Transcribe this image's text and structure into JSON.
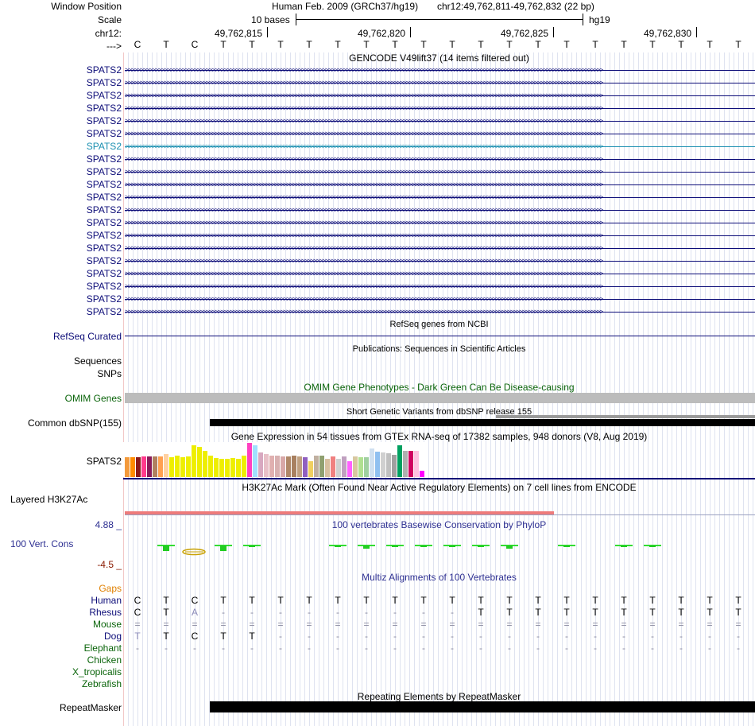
{
  "header": {
    "window_position_label": "Window Position",
    "scale_label": "Scale",
    "chrom_label": "chr12:",
    "strand_label": "--->",
    "assembly_text": "Human Feb. 2009 (GRCh37/hg19)",
    "position_text": "chr12:49,762,811-49,762,832 (22 bp)",
    "scale_text": "10 bases",
    "db_text": "hg19",
    "ticks": [
      "49,762,815",
      "49,762,820",
      "49,762,825",
      "49,762,830"
    ]
  },
  "sequence": [
    "C",
    "T",
    "C",
    "T",
    "T",
    "T",
    "T",
    "T",
    "T",
    "T",
    "T",
    "T",
    "T",
    "T",
    "T",
    "T",
    "T",
    "T",
    "T",
    "T",
    "T",
    "T"
  ],
  "gencode": {
    "title": "GENCODE V49lift37 (14 items filtered out)",
    "gene_labels": [
      "SPATS2",
      "SPATS2",
      "SPATS2",
      "SPATS2",
      "SPATS2",
      "SPATS2",
      "SPATS2",
      "SPATS2",
      "SPATS2",
      "SPATS2",
      "SPATS2",
      "SPATS2",
      "SPATS2",
      "SPATS2",
      "SPATS2",
      "SPATS2",
      "SPATS2",
      "SPATS2",
      "SPATS2",
      "SPATS2"
    ],
    "highlight_index": 6,
    "colors": {
      "normal": "#0c0c78",
      "highlight": "#1a8fb0"
    }
  },
  "refseq": {
    "label": "RefSeq Curated",
    "title": "RefSeq genes from NCBI",
    "color": "#0c0c78"
  },
  "pubs": {
    "title": "Publications: Sequences in Scientific Articles",
    "labels": [
      "Sequences",
      "SNPs"
    ]
  },
  "omim": {
    "label": "OMIM Genes",
    "title": "OMIM Gene Phenotypes - Dark Green Can Be Disease-causing",
    "color": "#0a640a"
  },
  "dbsnp": {
    "label": "Common dbSNP(155)",
    "title": "Short Genetic Variants from dbSNP release 155"
  },
  "gtex": {
    "label": "SPATS2",
    "title": "Gene Expression in 54 tissues from GTEx RNA-seq of 17382 samples, 948 donors (V8, Aug 2019)",
    "levels": [
      0.56,
      0.56,
      0.56,
      0.6,
      0.58,
      0.6,
      0.58,
      0.66,
      0.56,
      0.62,
      0.56,
      0.6,
      0.9,
      0.86,
      0.76,
      0.62,
      0.54,
      0.52,
      0.52,
      0.54,
      0.52,
      0.62,
      0.98,
      0.9,
      0.7,
      0.66,
      0.62,
      0.62,
      0.58,
      0.58,
      0.62,
      0.6,
      0.56,
      0.45,
      0.62,
      0.62,
      0.52,
      0.58,
      0.52,
      0.6,
      0.45,
      0.6,
      0.56,
      0.56,
      0.82,
      0.72,
      0.7,
      0.68,
      0.64,
      0.92,
      0.74,
      0.76,
      0.74,
      0.18
    ],
    "colors": [
      "#f39a3c",
      "#ff8c00",
      "#8b1a1a",
      "#ff3a8c",
      "#8b1a5a",
      "#b08060",
      "#ffa050",
      "#ffd0a0",
      "#eeee00",
      "#eeee00",
      "#eeee00",
      "#eeee00",
      "#eeee00",
      "#eeee00",
      "#eeee00",
      "#eeee00",
      "#eeee00",
      "#eeee00",
      "#eeee00",
      "#eeee00",
      "#eeee00",
      "#eeee00",
      "#ff40c0",
      "#a0e0ff",
      "#d8a8c0",
      "#e8c0c8",
      "#e0b0b0",
      "#d8b0b0",
      "#d8a8a8",
      "#b08868",
      "#a88060",
      "#c0a080",
      "#9060c0",
      "#f0d060",
      "#c0b0a0",
      "#90a070",
      "#d8c0a0",
      "#f08080",
      "#d0d0d0",
      "#c0a0c0",
      "#ff60ff",
      "#d8c8a0",
      "#b0e090",
      "#a0d0a0",
      "#d0e0f0",
      "#90c0f0",
      "#d0d0d0",
      "#c0c0c0",
      "#a0a0a0",
      "#00a060",
      "#b0b0b0",
      "#d00060",
      "#ffc0e0",
      "#ff00ff"
    ]
  },
  "h3k27ac": {
    "label": "Layered H3K27Ac",
    "title": "H3K27Ac Mark (Often Found Near Active Regulatory Elements) on 7 cell lines from ENCODE"
  },
  "conservation": {
    "label": "100 Vert. Cons",
    "max": "4.88 _",
    "min": "-4.5 _",
    "title": "100 vertebrates Basewise Conservation by PhyloP",
    "colors": {
      "label": "#2e3092",
      "max": "#2e3092",
      "min": "#8a1a00"
    },
    "scores": [
      null,
      1.0,
      0.0,
      1.0,
      0.3,
      null,
      null,
      0.3,
      0.6,
      0.2,
      0.2,
      0.15,
      0.1,
      0.6,
      null,
      0.1,
      null,
      0.1,
      0.25,
      null,
      null,
      null
    ]
  },
  "multiz": {
    "title": "Multiz Alignments of 100 Vertebrates",
    "gaps_label": "Gaps",
    "species": [
      {
        "name": "Human",
        "bases": [
          "C",
          "T",
          "C",
          "T",
          "T",
          "T",
          "T",
          "T",
          "T",
          "T",
          "T",
          "T",
          "T",
          "T",
          "T",
          "T",
          "T",
          "T",
          "T",
          "T",
          "T",
          "T"
        ]
      },
      {
        "name": "Rhesus",
        "bases": [
          "C",
          "T",
          "A",
          "-",
          "-",
          "-",
          "-",
          "-",
          "-",
          "-",
          "-",
          "-",
          "T",
          "T",
          "T",
          "T",
          "T",
          "T",
          "T",
          "T",
          "T",
          "T"
        ]
      },
      {
        "name": "Mouse",
        "bases": [
          "=",
          "=",
          "=",
          "=",
          "=",
          "=",
          "=",
          "=",
          "=",
          "=",
          "=",
          "=",
          "=",
          "=",
          "=",
          "=",
          "=",
          "=",
          "=",
          "=",
          "=",
          "="
        ]
      },
      {
        "name": "Dog",
        "bases": [
          "T",
          "T",
          "C",
          "T",
          "T",
          "-",
          "-",
          "-",
          "-",
          "-",
          "-",
          "-",
          "-",
          "-",
          "-",
          "-",
          "-",
          "-",
          "-",
          "-",
          "-",
          "-"
        ]
      },
      {
        "name": "Elephant",
        "bases": [
          "-",
          "-",
          "-",
          "-",
          "-",
          "-",
          "-",
          "-",
          "-",
          "-",
          "-",
          "-",
          "-",
          "-",
          "-",
          "-",
          "-",
          "-",
          "-",
          "-",
          "-",
          "-"
        ]
      },
      {
        "name": "Chicken",
        "bases": []
      },
      {
        "name": "X_tropicalis",
        "bases": []
      },
      {
        "name": "Zebrafish",
        "bases": []
      }
    ],
    "colors": {
      "gaps": "#e08000",
      "mammal": "#0c0c78",
      "other": "#0a640a"
    }
  },
  "repeatmasker": {
    "label": "RepeatMasker",
    "title": "Repeating Elements by RepeatMasker"
  }
}
